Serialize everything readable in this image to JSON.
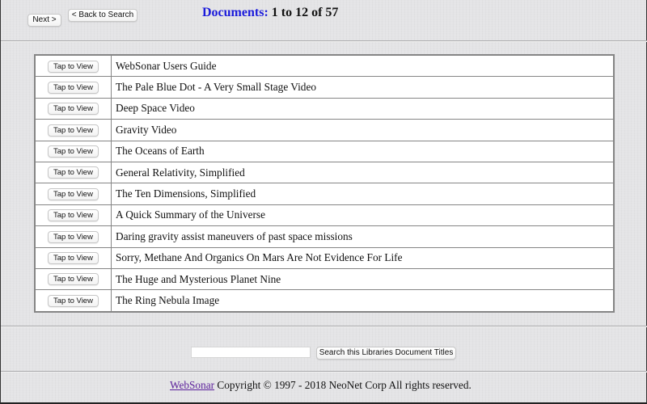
{
  "nav": {
    "next_label": "Next >",
    "back_label": "< Back to Search"
  },
  "header": {
    "documents_label": "Documents:",
    "range_text": "1 to 12 of 57"
  },
  "documents": [
    {
      "button_label": "Tap to View",
      "title": "WebSonar Users Guide"
    },
    {
      "button_label": "Tap to View",
      "title": "The Pale Blue Dot - A Very Small Stage Video"
    },
    {
      "button_label": "Tap to View",
      "title": "Deep Space Video"
    },
    {
      "button_label": "Tap to View",
      "title": "Gravity Video"
    },
    {
      "button_label": "Tap to View",
      "title": "The Oceans of Earth"
    },
    {
      "button_label": "Tap to View",
      "title": "General Relativity, Simplified"
    },
    {
      "button_label": "Tap to View",
      "title": "The Ten Dimensions, Simplified"
    },
    {
      "button_label": "Tap to View",
      "title": "A Quick Summary of the Universe"
    },
    {
      "button_label": "Tap to View",
      "title": "Daring gravity assist maneuvers of past space missions"
    },
    {
      "button_label": "Tap to View",
      "title": "Sorry, Methane And Organics On Mars Are Not Evidence For Life"
    },
    {
      "button_label": "Tap to View",
      "title": "The Huge and Mysterious Planet Nine"
    },
    {
      "button_label": "Tap to View",
      "title": "The Ring Nebula Image"
    }
  ],
  "search": {
    "value": "",
    "placeholder": "",
    "button_label": "Search this Libraries Document Titles"
  },
  "footer": {
    "link_text": "WebSonar",
    "copyright_text": " Copyright © 1997 - 2018 NeoNet Corp All rights reserved."
  },
  "colors": {
    "documents_label": "#1a1adb",
    "footer_link": "#5b1f9a",
    "background": "#e4e4e6"
  }
}
